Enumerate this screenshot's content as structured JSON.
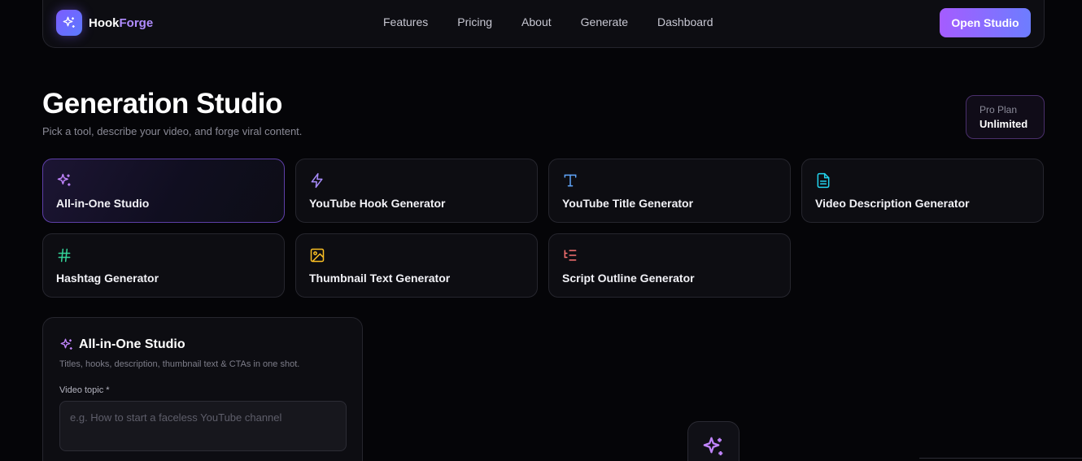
{
  "brand": {
    "name_part1": "Hook",
    "name_part2": "Forge",
    "logo_icon": "sparkles-icon"
  },
  "nav": {
    "links": [
      "Features",
      "Pricing",
      "About",
      "Generate",
      "Dashboard"
    ],
    "cta": "Open Studio"
  },
  "header": {
    "title": "Generation Studio",
    "subtitle": "Pick a tool, describe your video, and forge viral content."
  },
  "plan": {
    "label": "Pro Plan",
    "value": "Unlimited"
  },
  "tools": [
    {
      "label": "All-in-One Studio",
      "icon": "sparkles-icon",
      "color": "#c084fc",
      "active": true
    },
    {
      "label": "YouTube Hook Generator",
      "icon": "lightning-icon",
      "color": "#a78bfa"
    },
    {
      "label": "YouTube Title Generator",
      "icon": "type-icon",
      "color": "#60a5fa"
    },
    {
      "label": "Video Description Generator",
      "icon": "file-text-icon",
      "color": "#22d3ee"
    },
    {
      "label": "Hashtag Generator",
      "icon": "hash-icon",
      "color": "#34d399"
    },
    {
      "label": "Thumbnail Text Generator",
      "icon": "image-icon",
      "color": "#fbbf24"
    },
    {
      "label": "Script Outline Generator",
      "icon": "list-icon",
      "color": "#f87171"
    }
  ],
  "panel": {
    "title": "All-in-One Studio",
    "icon": "sparkles-icon",
    "subtitle": "Titles, hooks, description, thumbnail text & CTAs in one shot.",
    "field_label": "Video topic *",
    "placeholder": "e.g. How to start a faceless YouTube channel"
  },
  "colors": {
    "accent": "#a55cff",
    "accent2": "#6d7dff",
    "background": "#050508"
  }
}
